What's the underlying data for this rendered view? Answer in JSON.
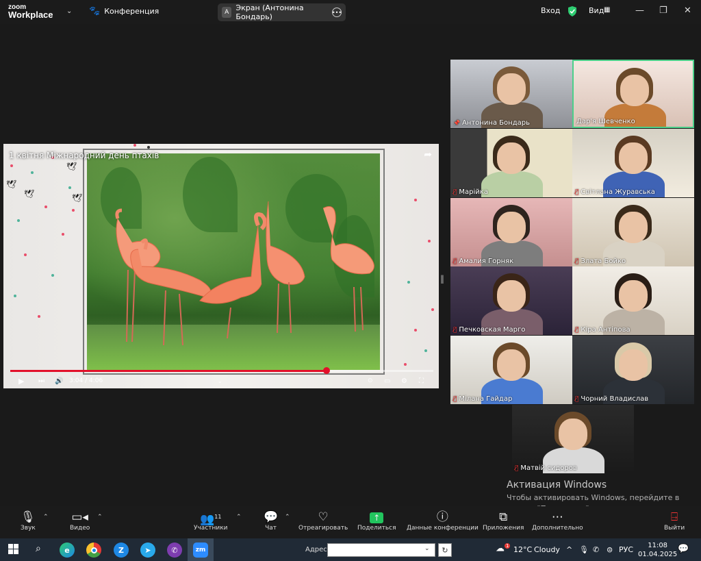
{
  "app": {
    "logo_line1": "zoom",
    "logo_line2": "Workplace",
    "conference_label": "Конференция",
    "screen_share_initial": "A",
    "screen_share_label": "Экран (Антонина Бондарь)",
    "login_label": "Вход",
    "view_label": "Вид"
  },
  "share": {
    "video_title": "1 квітня Міжнародний день птахів",
    "time": "3:04 / 4:06",
    "progress": 0.748
  },
  "gallery": [
    {
      "name": "Антонина Бондарь",
      "muted": false,
      "pinned": true,
      "active": false
    },
    {
      "name": "Дар'я Шевченко",
      "muted": false,
      "pinned": false,
      "active": true
    },
    {
      "name": "Марійка",
      "muted": true,
      "pinned": false,
      "active": false
    },
    {
      "name": "Світлана  Журавська",
      "muted": true,
      "pinned": false,
      "active": false
    },
    {
      "name": "Амалия Горняк",
      "muted": true,
      "pinned": false,
      "active": false
    },
    {
      "name": "Злата Бойко",
      "muted": true,
      "pinned": false,
      "active": false
    },
    {
      "name": "Печковская Марго",
      "muted": true,
      "pinned": false,
      "active": false
    },
    {
      "name": "Кіра Антіпова",
      "muted": true,
      "pinned": false,
      "active": false
    },
    {
      "name": "Мілана Гайдар",
      "muted": true,
      "pinned": false,
      "active": false
    },
    {
      "name": "Чорний Владислав",
      "muted": true,
      "pinned": false,
      "active": false
    },
    {
      "name": "Матвій сидоров",
      "muted": true,
      "pinned": false,
      "active": false
    }
  ],
  "watermark": {
    "title": "Активация Windows",
    "text": "Чтобы активировать Windows, перейдите в раздел \"Параметры\"."
  },
  "toolbar": {
    "audio": "Звук",
    "video": "Видео",
    "participants": "Участники",
    "participants_count": "11",
    "chat": "Чат",
    "react": "Отреагировать",
    "share": "Поделиться",
    "meeting_info": "Данные конференции",
    "apps": "Приложения",
    "more": "Дополнительно",
    "leave": "Выйти"
  },
  "taskbar": {
    "address_label": "Адрес",
    "zoom_app_label": "zm",
    "weather_temp": "12°C",
    "weather_text": "Cloudy",
    "weather_badge": "1",
    "language": "РУС",
    "time": "11:08",
    "date": "01.04.2025"
  },
  "colors": {
    "accent_green": "#4cd08a",
    "progress_red": "#e2102a",
    "share_green": "#22c55e",
    "mic_off_red": "#e33333"
  }
}
